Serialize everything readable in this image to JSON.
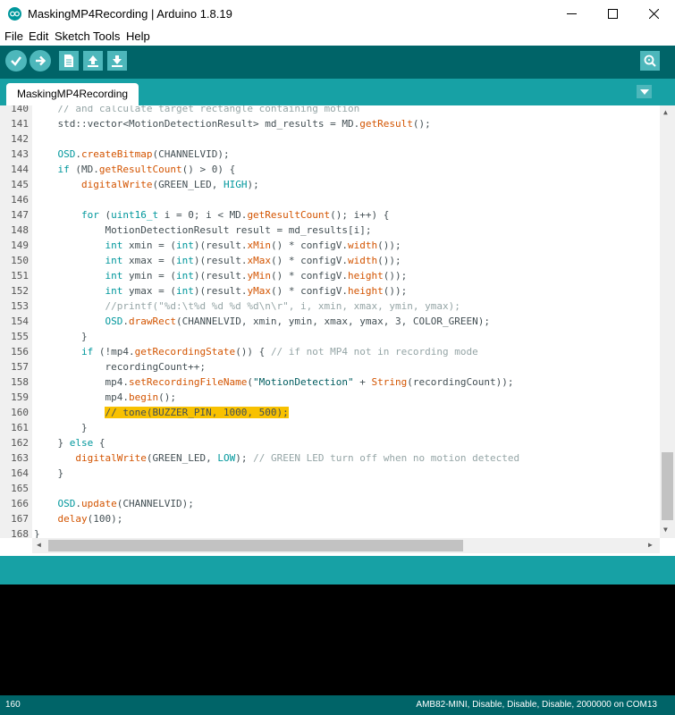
{
  "window": {
    "title": "MaskingMP4Recording | Arduino 1.8.19",
    "accent": "#00979c",
    "toolbar_color": "#006468",
    "tab_bar_color": "#17a1a5"
  },
  "menu": [
    "File",
    "Edit",
    "Sketch",
    "Tools",
    "Help"
  ],
  "toolbar": {
    "icons": [
      "verify-icon",
      "upload-icon",
      "new-icon",
      "open-icon",
      "save-icon",
      "serial-monitor-icon"
    ]
  },
  "tab": {
    "label": "MaskingMP4Recording"
  },
  "editor": {
    "highlight_line": 160,
    "lines": [
      {
        "n": "140",
        "t": "    // and calculate target rectangle containing motion"
      },
      {
        "n": "141",
        "t": "    std::vector<MotionDetectionResult> md_results = MD.getResult();"
      },
      {
        "n": "142",
        "t": ""
      },
      {
        "n": "143",
        "t": "    OSD.createBitmap(CHANNELVID);"
      },
      {
        "n": "144",
        "t": "    if (MD.getResultCount() > 0) {"
      },
      {
        "n": "145",
        "t": "        digitalWrite(GREEN_LED, HIGH);"
      },
      {
        "n": "146",
        "t": ""
      },
      {
        "n": "147",
        "t": "        for (uint16_t i = 0; i < MD.getResultCount(); i++) {"
      },
      {
        "n": "148",
        "t": "            MotionDetectionResult result = md_results[i];"
      },
      {
        "n": "149",
        "t": "            int xmin = (int)(result.xMin() * configV.width());"
      },
      {
        "n": "150",
        "t": "            int xmax = (int)(result.xMax() * configV.width());"
      },
      {
        "n": "151",
        "t": "            int ymin = (int)(result.yMin() * configV.height());"
      },
      {
        "n": "152",
        "t": "            int ymax = (int)(result.yMax() * configV.height());"
      },
      {
        "n": "153",
        "t": "            //printf(\"%d:\\t%d %d %d %d\\n\\r\", i, xmin, xmax, ymin, ymax);"
      },
      {
        "n": "154",
        "t": "            OSD.drawRect(CHANNELVID, xmin, ymin, xmax, ymax, 3, COLOR_GREEN);"
      },
      {
        "n": "155",
        "t": "        }"
      },
      {
        "n": "156",
        "t": "        if (!mp4.getRecordingState()) { // if not MP4 not in recording mode"
      },
      {
        "n": "157",
        "t": "            recordingCount++;"
      },
      {
        "n": "158",
        "t": "            mp4.setRecordingFileName(\"MotionDetection\" + String(recordingCount));"
      },
      {
        "n": "159",
        "t": "            mp4.begin();"
      },
      {
        "n": "160",
        "t": "            // tone(BUZZER_PIN, 1000, 500);"
      },
      {
        "n": "161",
        "t": "        }"
      },
      {
        "n": "162",
        "t": "    } else {"
      },
      {
        "n": "163",
        "t": "       digitalWrite(GREEN_LED, LOW); // GREEN LED turn off when no motion detected"
      },
      {
        "n": "164",
        "t": "    }"
      },
      {
        "n": "165",
        "t": ""
      },
      {
        "n": "166",
        "t": "    OSD.update(CHANNELVID);"
      },
      {
        "n": "167",
        "t": "    delay(100);"
      },
      {
        "n": "168",
        "t": "}"
      }
    ]
  },
  "status": {
    "line": "160",
    "board": "AMB82-MINI, Disable, Disable, Disable, 2000000 on COM13"
  }
}
